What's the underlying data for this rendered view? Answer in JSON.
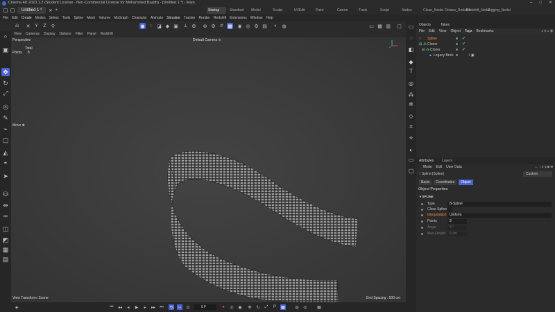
{
  "window": {
    "title": "Cinema 4D 2023.1.2 (Student License - Non-Commercial License for Mohammed Basith) - [Untitled 1 *] - Main",
    "controls": [
      "–",
      "□",
      "✕"
    ]
  },
  "tabs": {
    "document": "Untitled 1 *",
    "layouts": [
      "Startup",
      "Standard",
      "Model",
      "Sculpt",
      "UVEdit",
      "Paint",
      "Groom",
      "Track",
      "Script",
      "Nodes",
      "Clean_Nodal",
      "Octane_Redshift",
      "Redshift_Nodal",
      "Rigging_Nodal"
    ],
    "active_layout": "Startup"
  },
  "menubar": [
    "File",
    "Edit",
    "Create",
    "Modes",
    "Select",
    "Tools",
    "Spline",
    "Mesh",
    "Volume",
    "MoGraph",
    "Character",
    "Animate",
    "Simulate",
    "Tracker",
    "Render",
    "Redshift",
    "Extensions",
    "Window",
    "Help"
  ],
  "viewport": {
    "menu": [
      "View",
      "Cameras",
      "Display",
      "Options",
      "Filter",
      "Panel",
      "Redshift"
    ],
    "label": "Perspective",
    "camera": "Default Camera",
    "stats_header": "Total",
    "stats_label": "Points",
    "stats_value": "8",
    "tool_label": "Move",
    "transform": "View Transform: Scene",
    "grid": "Grid Spacing : 500 cm"
  },
  "timeline": {
    "frame": "0 F"
  },
  "objects": {
    "tabs": [
      "Objects",
      "Takes"
    ],
    "menu": [
      "File",
      "Edit",
      "View",
      "Object",
      "Tags",
      "Bookmarks"
    ],
    "items": [
      {
        "name": "Spline",
        "selected": true
      },
      {
        "name": "Cloner",
        "selected": false
      },
      {
        "name": "Cloner",
        "selected": false
      },
      {
        "name": "Legacy Brick",
        "selected": false
      }
    ]
  },
  "attributes": {
    "tabs": [
      "Attributes",
      "Layers"
    ],
    "menu": [
      "Mode",
      "Edit",
      "User Data"
    ],
    "object_name": "Spline [Spline]",
    "mode": "Custom",
    "subtabs": [
      "Basic",
      "Coordinates",
      "Object"
    ],
    "active_subtab": "Object",
    "section": "Object Properties",
    "group": "SPLINE",
    "props": [
      {
        "label": "Type",
        "value": "B-Spline"
      },
      {
        "label": "Close Spline",
        "value": ""
      },
      {
        "label": "Interpolation",
        "value": "Uniform"
      },
      {
        "label": "Points",
        "value": "8"
      },
      {
        "label": "Angle",
        "value": "5 °"
      },
      {
        "label": "Max Length",
        "value": "5 cm"
      }
    ]
  },
  "colors": {
    "accent": "#4a63d6",
    "selection": "#ff8a3d",
    "check": "#4fd15b"
  }
}
